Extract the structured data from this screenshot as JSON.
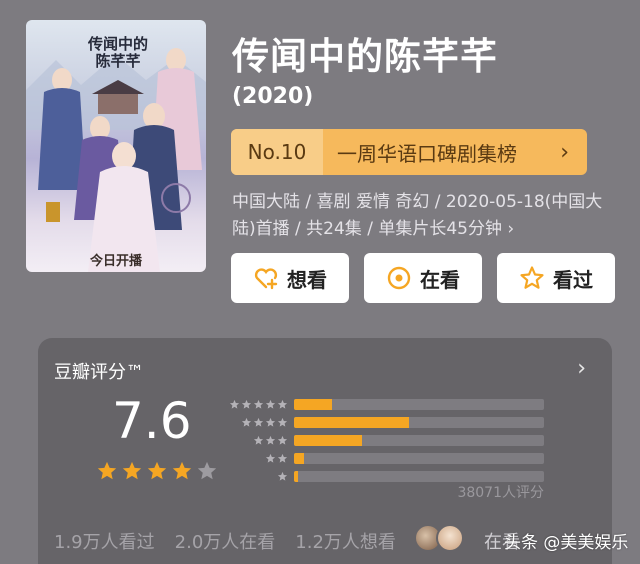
{
  "poster": {
    "title": "传闻中的陈芊芊",
    "subtitle": "今日开播"
  },
  "header": {
    "title": "传闻中的陈芊芊",
    "year": "(2020)"
  },
  "rank": {
    "number": "No.10",
    "label": "一周华语口碑剧集榜",
    "chevron": "›"
  },
  "meta": {
    "text": "中国大陆 / 喜剧 爱情 奇幻 / 2020-05-18(中国大陆)首播 / 共24集 / 单集片长45分钟 ›"
  },
  "actions": [
    {
      "label": "想看",
      "icon": "heart-plus-icon"
    },
    {
      "label": "在看",
      "icon": "circle-dot-icon"
    },
    {
      "label": "看过",
      "icon": "star-outline-icon"
    }
  ],
  "rating": {
    "title": "豆瓣评分™",
    "chevron": "›",
    "score": "7.6",
    "stars_filled": 4,
    "stars_total": 5,
    "distribution": [
      {
        "stars": 5,
        "fraction": 0.15
      },
      {
        "stars": 4,
        "fraction": 0.46
      },
      {
        "stars": 3,
        "fraction": 0.27
      },
      {
        "stars": 2,
        "fraction": 0.04
      },
      {
        "stars": 1,
        "fraction": 0.015
      }
    ],
    "votes": "38071人评分",
    "stats": {
      "watched": "1.9万人看过",
      "watching": "2.0万人在看",
      "want": "1.2万人想看"
    },
    "friend_text": "在看"
  },
  "watermark": "头条 @美美娱乐",
  "colors": {
    "background": "#7d7b80",
    "accent": "#f5a623",
    "rank_bg": "#f6b95c",
    "card_bg": "#666468"
  }
}
